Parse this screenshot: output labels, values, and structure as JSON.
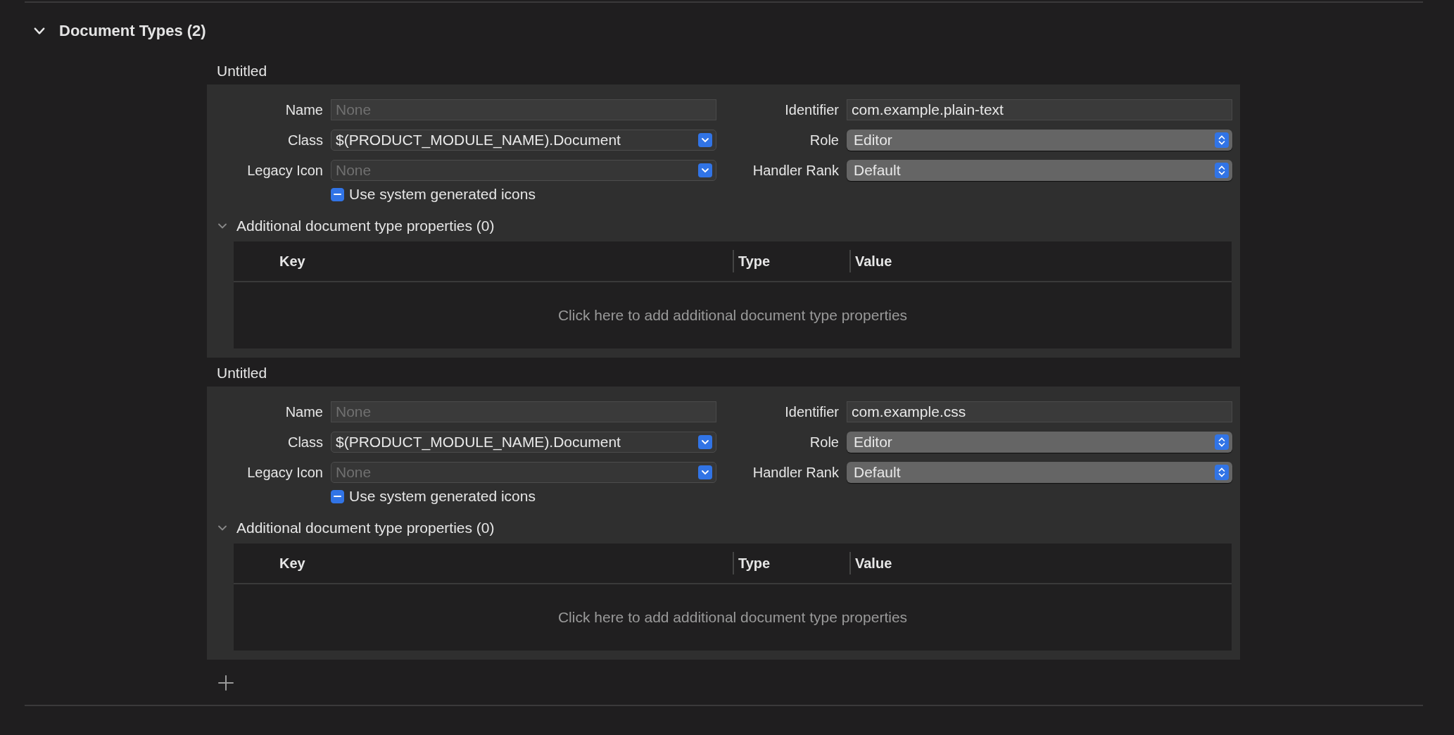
{
  "section": {
    "title": "Document Types (2)",
    "expanded": true
  },
  "document_types": [
    {
      "heading": "Untitled",
      "left_fields": [
        {
          "label": "Name",
          "kind": "text",
          "placeholder": "None"
        },
        {
          "label": "Class",
          "kind": "combo",
          "value": "$(PRODUCT_MODULE_NAME).Document"
        },
        {
          "label": "Legacy Icon",
          "kind": "combo",
          "placeholder": "None"
        }
      ],
      "right_fields": [
        {
          "label": "Identifier",
          "kind": "text",
          "value": "com.example.plain-text"
        },
        {
          "label": "Role",
          "kind": "popup",
          "value": "Editor"
        },
        {
          "label": "Handler Rank",
          "kind": "popup",
          "value": "Default"
        }
      ],
      "checkbox": {
        "label": "Use system generated icons",
        "mixed": true
      },
      "properties": {
        "title": "Additional document type properties (0)",
        "expanded": true,
        "columns": [
          "Key",
          "Type",
          "Value"
        ],
        "empty_text": "Click here to add additional document type properties"
      }
    },
    {
      "heading": "Untitled",
      "left_fields": [
        {
          "label": "Name",
          "kind": "text",
          "placeholder": "None"
        },
        {
          "label": "Class",
          "kind": "combo",
          "value": "$(PRODUCT_MODULE_NAME).Document"
        },
        {
          "label": "Legacy Icon",
          "kind": "combo",
          "placeholder": "None"
        }
      ],
      "right_fields": [
        {
          "label": "Identifier",
          "kind": "text",
          "value": "com.example.css"
        },
        {
          "label": "Role",
          "kind": "popup",
          "value": "Editor"
        },
        {
          "label": "Handler Rank",
          "kind": "popup",
          "value": "Default"
        }
      ],
      "checkbox": {
        "label": "Use system generated icons",
        "mixed": true
      },
      "properties": {
        "title": "Additional document type properties (0)",
        "expanded": true,
        "columns": [
          "Key",
          "Type",
          "Value"
        ],
        "empty_text": "Click here to add additional document type properties"
      }
    }
  ]
}
